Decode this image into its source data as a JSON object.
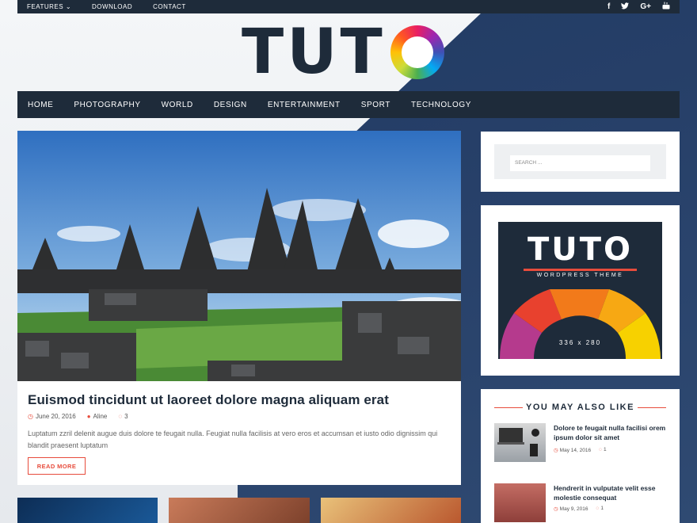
{
  "topbar": {
    "items": [
      "FEATURES",
      "DOWNLOAD",
      "CONTACT"
    ],
    "features_chevron": "⌄",
    "social": [
      "f",
      "t",
      "G+",
      "yt"
    ]
  },
  "logo": {
    "text": "TUT"
  },
  "nav": {
    "items": [
      "HOME",
      "PHOTOGRAPHY",
      "WORLD",
      "DESIGN",
      "ENTERTAINMENT",
      "SPORT",
      "TECHNOLOGY"
    ]
  },
  "featured": {
    "title": "Euismod tincidunt ut laoreet dolore magna aliquam erat",
    "date": "June 20, 2016",
    "author": "Aline",
    "comments": "3",
    "excerpt": "Luptatum zzril delenit augue duis dolore te feugait nulla. Feugiat nulla facilisis at vero eros et accumsan et iusto odio dignissim qui blandit praesent luptatum",
    "read_more": "READ MORE"
  },
  "search": {
    "placeholder": "SEARCH ..."
  },
  "ad": {
    "title": "TUTO",
    "subtitle": "WORDPRESS THEME",
    "size": "336 x 280"
  },
  "related": {
    "heading": "YOU MAY ALSO LIKE",
    "items": [
      {
        "title": "Dolore te feugait nulla facilisi orem ipsum dolor sit amet",
        "date": "May 14, 2016",
        "comments": "1"
      },
      {
        "title": "Hendrerit in vulputate velit esse molestie consequat",
        "date": "May 9, 2016",
        "comments": "1"
      }
    ]
  },
  "colors": {
    "dark": "#1e2b3a",
    "accent": "#e74c3c"
  }
}
